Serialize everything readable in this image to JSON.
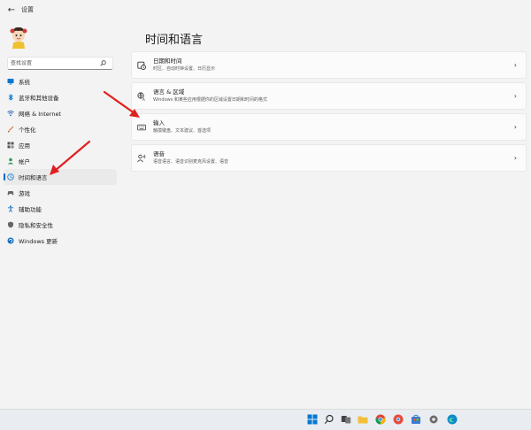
{
  "window": {
    "title": "设置"
  },
  "search": {
    "placeholder": "查找设置"
  },
  "nav": [
    {
      "label": "系统",
      "icon": "system-icon",
      "color": "#0078d4"
    },
    {
      "label": "蓝牙和其他设备",
      "icon": "bluetooth-icon",
      "color": "#0078d4"
    },
    {
      "label": "网络 & Internet",
      "icon": "network-icon",
      "color": "#2b66b5"
    },
    {
      "label": "个性化",
      "icon": "personalization-icon",
      "color": "#c46a2a"
    },
    {
      "label": "应用",
      "icon": "apps-icon",
      "color": "#555555"
    },
    {
      "label": "帐户",
      "icon": "accounts-icon",
      "color": "#2e9a58"
    },
    {
      "label": "时间和语言",
      "icon": "time-language-icon",
      "color": "#1f7fd1",
      "active": true
    },
    {
      "label": "游戏",
      "icon": "gaming-icon",
      "color": "#666666"
    },
    {
      "label": "辅助功能",
      "icon": "accessibility-icon",
      "color": "#1a70c8"
    },
    {
      "label": "隐私和安全性",
      "icon": "privacy-icon",
      "color": "#666666"
    },
    {
      "label": "Windows 更新",
      "icon": "windows-update-icon",
      "color": "#0f6cbd"
    }
  ],
  "page": {
    "title": "时间和语言"
  },
  "cards": [
    {
      "title": "日期和时间",
      "subtitle": "时区、自动时钟设置、日历显示",
      "icon": "clock-icon"
    },
    {
      "title": "语言 & 区域",
      "subtitle": "Windows 和某些应用根据你的区域设置日期和时间的格式",
      "icon": "language-icon"
    },
    {
      "title": "输入",
      "subtitle": "触摸键盘、文本建议、首选项",
      "icon": "keyboard-icon"
    },
    {
      "title": "语音",
      "subtitle": "语音语言、语音识别麦克风设置、语音",
      "icon": "speech-icon"
    }
  ],
  "colors": {
    "accent": "#0067c0",
    "arrow": "#e02020"
  }
}
